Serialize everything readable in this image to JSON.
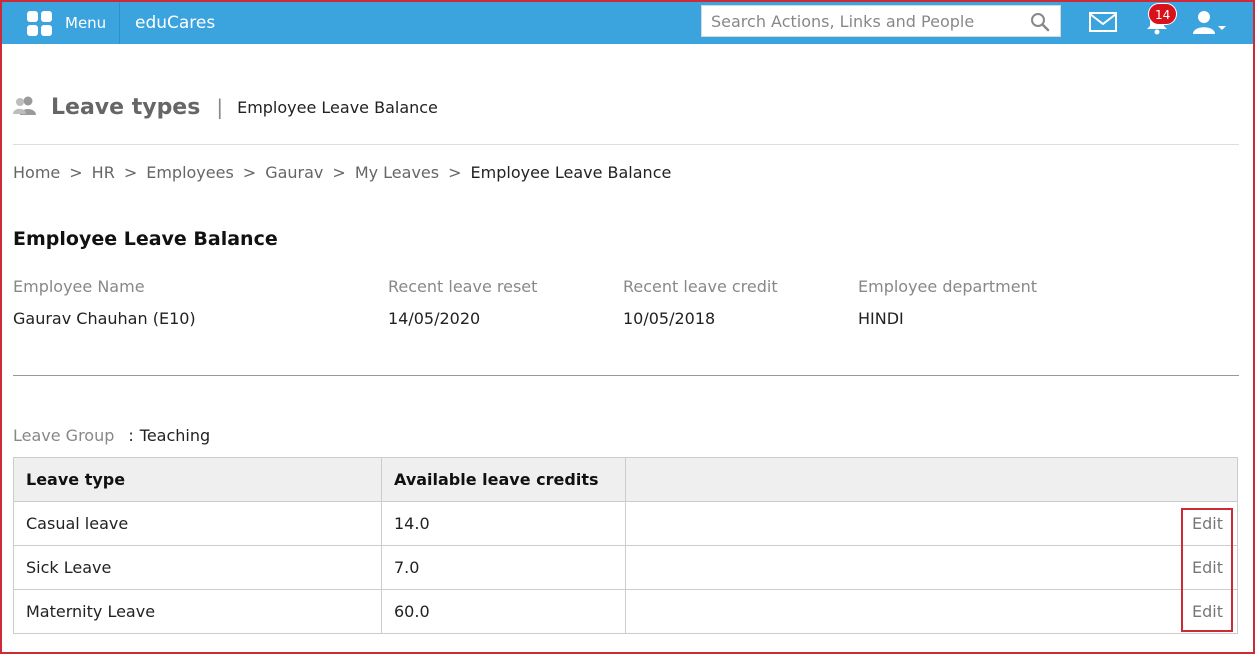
{
  "topbar": {
    "menu_label": "Menu",
    "app_name": "eduCares",
    "search_placeholder": "Search Actions, Links and People",
    "notification_count": "14",
    "colors": {
      "bar": "#3ba3dd",
      "badge": "#d8121b"
    }
  },
  "page": {
    "title": "Leave types",
    "separator": "|",
    "subtitle": "Employee Leave Balance"
  },
  "breadcrumb": [
    "Home",
    "HR",
    "Employees",
    "Gaurav",
    "My Leaves",
    "Employee Leave Balance"
  ],
  "breadcrumb_separator": ">",
  "section_title": "Employee Leave Balance",
  "employee": {
    "name_label": "Employee Name",
    "name_value": "Gaurav Chauhan (E10)",
    "reset_label": "Recent leave reset",
    "reset_value": "14/05/2020",
    "credit_label": "Recent leave credit",
    "credit_value": "10/05/2018",
    "dept_label": "Employee department",
    "dept_value": "HINDI"
  },
  "leave_group": {
    "label": "Leave Group",
    "separator": ":",
    "value": "Teaching"
  },
  "table": {
    "headers": [
      "Leave type",
      "Available leave credits",
      ""
    ],
    "rows": [
      {
        "type": "Casual leave",
        "credits": "14.0",
        "action": "Edit"
      },
      {
        "type": "Sick Leave",
        "credits": "7.0",
        "action": "Edit"
      },
      {
        "type": "Maternity Leave",
        "credits": "60.0",
        "action": "Edit"
      }
    ]
  },
  "icons": [
    "grid-menu-icon",
    "search-icon",
    "mail-icon",
    "bell-icon",
    "user-icon",
    "people-icon"
  ]
}
